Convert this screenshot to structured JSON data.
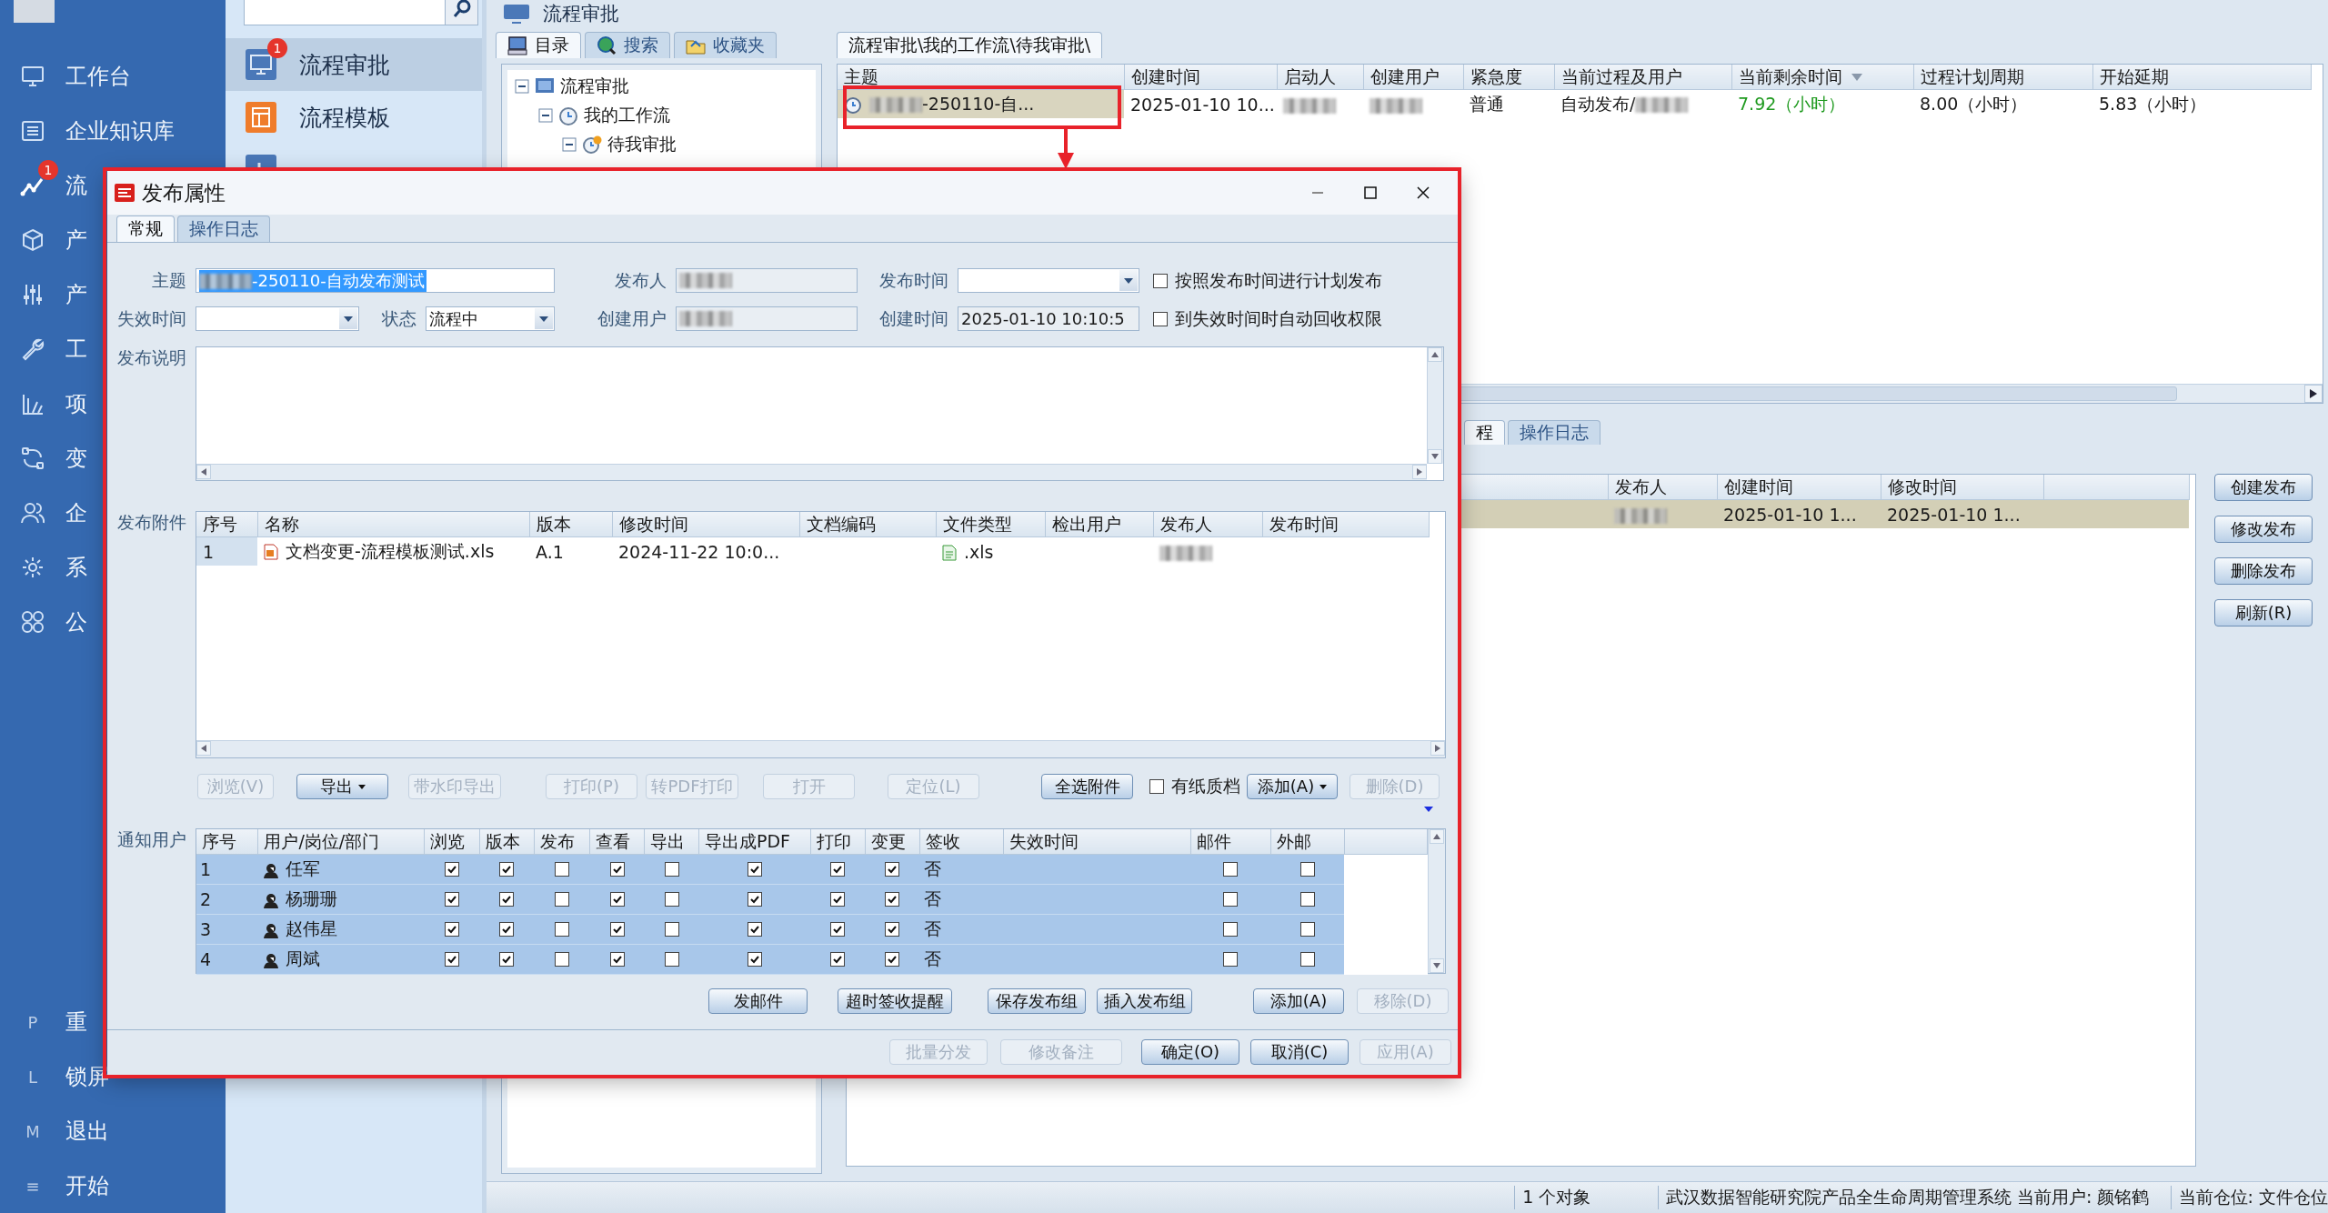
{
  "sidebar": {
    "items": [
      {
        "label": "工作台"
      },
      {
        "label": "企业知识库"
      },
      {
        "label": "流",
        "badge": "1"
      },
      {
        "label": "产"
      },
      {
        "label": "产"
      },
      {
        "label": "工"
      },
      {
        "label": "项"
      },
      {
        "label": "变"
      },
      {
        "label": "企"
      },
      {
        "label": "系"
      },
      {
        "label": "公"
      }
    ],
    "shortcuts": [
      {
        "key": "P",
        "label": "重"
      },
      {
        "key": "L",
        "label": "锁屏"
      },
      {
        "key": "M",
        "label": "退出"
      },
      {
        "key": "≡",
        "label": "开始"
      }
    ]
  },
  "nav": {
    "items": [
      {
        "label": "流程审批",
        "selected": true,
        "badge": "1"
      },
      {
        "label": "流程模板",
        "selected": false
      },
      {
        "selected": false
      }
    ]
  },
  "main": {
    "title": "流程审批",
    "tree_tabs": [
      {
        "label": "目录",
        "selected": true
      },
      {
        "label": "搜索",
        "selected": false
      },
      {
        "label": "收藏夹",
        "selected": false
      }
    ],
    "tree": [
      {
        "label": "流程审批",
        "expanded": true,
        "children": [
          {
            "label": "我的工作流",
            "expanded": true,
            "children": [
              {
                "label": "待我审批",
                "expanded": true
              }
            ]
          }
        ]
      }
    ],
    "path_tab": "流程审批\\我的工作流\\待我审批\\",
    "table": {
      "columns": [
        {
          "label": "主题",
          "sorted": false
        },
        {
          "label": "创建时间",
          "sorted": false
        },
        {
          "label": "启动人",
          "sorted": false
        },
        {
          "label": "创建用户",
          "sorted": false
        },
        {
          "label": "紧急度",
          "sorted": false
        },
        {
          "label": "当前过程及用户",
          "sorted": false
        },
        {
          "label": "当前剩余时间",
          "sorted": true
        },
        {
          "label": "过程计划周期",
          "sorted": false
        },
        {
          "label": "开始延期",
          "sorted": false
        }
      ],
      "rows": [
        {
          "selected": true,
          "cells": [
            {
              "text": "-250110-自...",
              "redacted": true
            },
            "2025-01-10 10...",
            {
              "redacted": true
            },
            {
              "redacted": true
            },
            "普通",
            {
              "text": "自动发布/",
              "redacted": true
            },
            {
              "text": "7.92（小时）",
              "color": "#1f9a1f"
            },
            "8.00（小时）",
            "5.83（小时）"
          ]
        }
      ]
    },
    "lower_tabs": [
      {
        "label": "程",
        "selected": true
      },
      {
        "label": "操作日志",
        "selected": false
      }
    ],
    "lower_table": {
      "columns": [
        "发布人",
        "创建时间",
        "修改时间"
      ],
      "rows": [
        {
          "selected": true,
          "cells": [
            {
              "redacted": true
            },
            "2025-01-10 1...",
            "2025-01-10 1..."
          ]
        }
      ]
    },
    "actions": [
      "创建发布",
      "修改发布",
      "删除发布",
      "刷新(R)"
    ],
    "status_bar": [
      "1 个对象",
      "武汉数据智能研究院产品全生命周期管理系统 当前用户: 颜铭鹤",
      "当前仓位: 文件仓位"
    ]
  },
  "dialog": {
    "title": "发布属性",
    "tabs": [
      {
        "label": "常规",
        "selected": true
      },
      {
        "label": "操作日志",
        "selected": false
      }
    ],
    "subject": {
      "label": "主题",
      "value": "-250110-自动发布测试",
      "redacted": true,
      "text_selected": true
    },
    "publisher": {
      "label": "发布人",
      "redacted": true
    },
    "publish_time": {
      "label": "发布时间"
    },
    "plan_publish": {
      "label": "按照发布时间进行计划发布",
      "checked": false
    },
    "expire_time": {
      "label": "失效时间"
    },
    "status": {
      "label": "状态",
      "value": "流程中"
    },
    "creator": {
      "label": "创建用户",
      "redacted": true
    },
    "created_time": {
      "label": "创建时间",
      "value": "2025-01-10 10:10:5"
    },
    "auto_revoke": {
      "label": "到失效时间时自动回收权限",
      "checked": false
    },
    "description": {
      "label": "发布说明"
    },
    "attachments": {
      "label": "发布附件",
      "columns": [
        "序号",
        "名称",
        "版本",
        "修改时间",
        "文档编码",
        "文件类型",
        "检出用户",
        "发布人",
        "发布时间"
      ],
      "rows": [
        {
          "cells": [
            "1",
            "文档变更-流程模板测试.xls",
            "A.1",
            "2024-11-22 10:0...",
            null,
            ".xls",
            null,
            {
              "redacted": true
            },
            null
          ]
        }
      ],
      "buttons": [
        {
          "kind": "button",
          "label": "浏览(V)",
          "disabled": true
        },
        {
          "kind": "menu",
          "label": "导出",
          "disabled": false
        },
        {
          "kind": "button",
          "label": "带水印导出",
          "disabled": true
        },
        {
          "kind": "button",
          "label": "打印(P)",
          "disabled": true
        },
        {
          "kind": "button",
          "label": "转PDF打印",
          "disabled": true
        },
        {
          "kind": "button",
          "label": "打开",
          "disabled": true
        },
        {
          "kind": "button",
          "label": "定位(L)",
          "disabled": true
        },
        {
          "kind": "button",
          "label": "全选附件",
          "disabled": false
        },
        {
          "kind": "checkbox",
          "label": "有纸质档",
          "checked": false
        },
        {
          "kind": "menu",
          "label": "添加(A)",
          "disabled": false
        },
        {
          "kind": "button",
          "label": "删除(D)",
          "disabled": true
        }
      ]
    },
    "users": {
      "label": "通知用户",
      "columns": [
        "序号",
        "用户/岗位/部门",
        "浏览",
        "版本",
        "发布",
        "查看",
        "导出",
        "导出成PDF",
        "打印",
        "变更",
        "签收",
        "失效时间",
        "邮件",
        "外邮"
      ],
      "rows": [
        {
          "index": "1",
          "name": "任军",
          "selected": true,
          "checked": [
            true,
            true,
            false,
            true,
            false,
            true,
            true,
            true
          ],
          "signed": "否",
          "mail": false,
          "external_mail": false
        },
        {
          "index": "2",
          "name": "杨珊珊",
          "selected": true,
          "checked": [
            true,
            true,
            false,
            true,
            false,
            true,
            true,
            true
          ],
          "signed": "否",
          "mail": false,
          "external_mail": false
        },
        {
          "index": "3",
          "name": "赵伟星",
          "selected": true,
          "checked": [
            true,
            true,
            false,
            true,
            false,
            true,
            true,
            true
          ],
          "signed": "否",
          "mail": false,
          "external_mail": false
        },
        {
          "index": "4",
          "name": "周斌",
          "selected": true,
          "checked": [
            true,
            true,
            false,
            true,
            false,
            true,
            true,
            true
          ],
          "signed": "否",
          "mail": false,
          "external_mail": false
        }
      ],
      "buttons": [
        {
          "label": "发邮件",
          "disabled": false
        },
        {
          "label": "超时签收提醒",
          "disabled": false
        },
        {
          "label": "保存发布组",
          "disabled": false
        },
        {
          "label": "插入发布组",
          "disabled": false
        },
        {
          "label": "添加(A)",
          "disabled": false
        },
        {
          "label": "移除(D)",
          "disabled": true
        }
      ]
    },
    "footer_buttons": [
      {
        "label": "批量分发",
        "disabled": true
      },
      {
        "label": "修改备注",
        "disabled": true
      },
      {
        "label": "确定(O)",
        "disabled": false
      },
      {
        "label": "取消(C)",
        "disabled": false
      },
      {
        "label": "应用(A)",
        "disabled": true
      }
    ]
  },
  "annotations": [
    {
      "kind": "frame"
    },
    {
      "kind": "arrow"
    },
    {
      "kind": "frame"
    }
  ]
}
